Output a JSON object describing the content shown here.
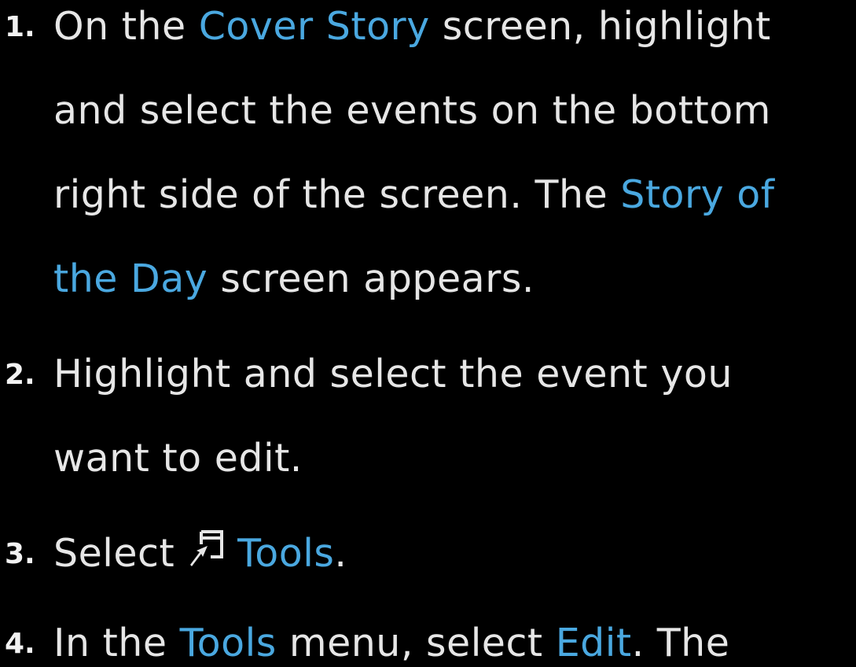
{
  "colors": {
    "background": "#000000",
    "text": "#e6e6e6",
    "highlight": "#4aa8e0"
  },
  "steps": [
    {
      "number": "1.",
      "lines": [
        {
          "parts": [
            {
              "text": "On the ",
              "hl": false
            },
            {
              "text": "Cover Story",
              "hl": true
            },
            {
              "text": " screen, highlight",
              "hl": false
            }
          ]
        },
        {
          "parts": [
            {
              "text": "and select the events on the bottom",
              "hl": false
            }
          ]
        },
        {
          "parts": [
            {
              "text": "right side of the screen. The ",
              "hl": false
            },
            {
              "text": "Story of",
              "hl": true
            }
          ]
        },
        {
          "parts": [
            {
              "text": "the Day",
              "hl": true
            },
            {
              "text": " screen appears.",
              "hl": false
            }
          ]
        }
      ]
    },
    {
      "number": "2.",
      "lines": [
        {
          "parts": [
            {
              "text": "Highlight and select the event you",
              "hl": false
            }
          ]
        },
        {
          "parts": [
            {
              "text": "want to edit.",
              "hl": false
            }
          ]
        }
      ]
    },
    {
      "number": "3.",
      "icon": "tools-icon",
      "lines": [
        {
          "parts": [
            {
              "text": "Select",
              "hl": false
            },
            {
              "icon": "tools-icon"
            },
            {
              "text": "Tools",
              "hl": true
            },
            {
              "text": ".",
              "hl": false
            }
          ]
        }
      ]
    },
    {
      "number": "4.",
      "lines": [
        {
          "parts": [
            {
              "text": "In the ",
              "hl": false
            },
            {
              "text": "Tools",
              "hl": true
            },
            {
              "text": " menu, select ",
              "hl": false
            },
            {
              "text": "Edit",
              "hl": true
            },
            {
              "text": ". The",
              "hl": false
            }
          ]
        }
      ]
    }
  ]
}
